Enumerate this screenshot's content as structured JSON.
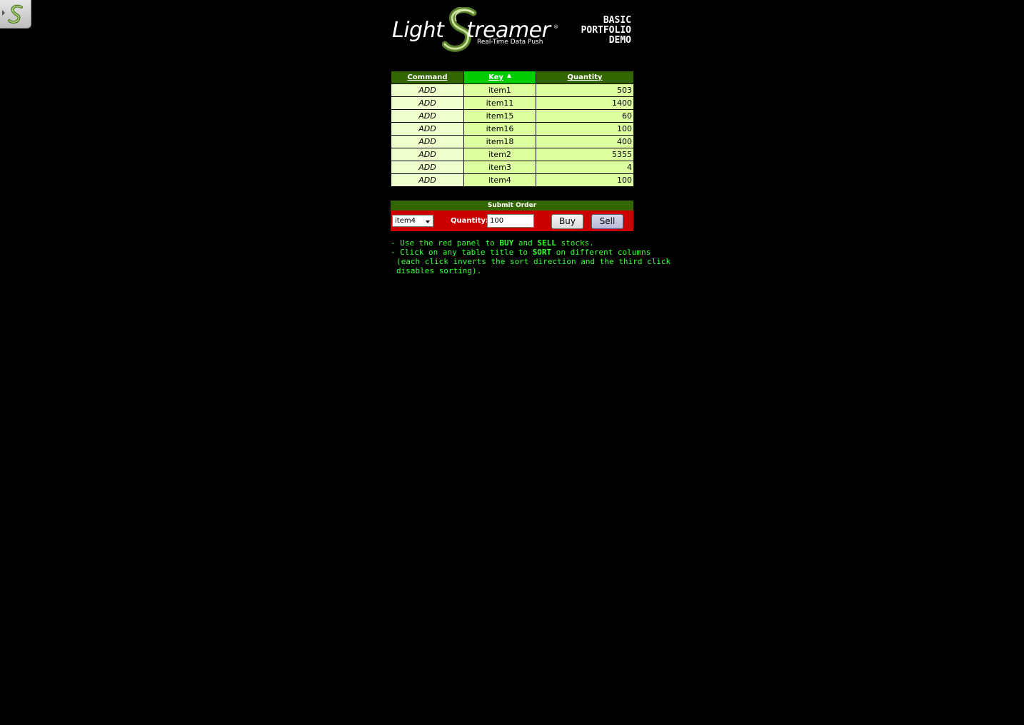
{
  "side_tab": {
    "icon": "lightstreamer-s-icon"
  },
  "header": {
    "logo_light": "Light",
    "logo_s": "S",
    "logo_streamer": "treamer",
    "logo_reg": "®",
    "logo_tagline": "Real-Time Data Push",
    "demo_title_line1": "BASIC",
    "demo_title_line2": "PORTFOLIO",
    "demo_title_line3": "DEMO"
  },
  "table": {
    "columns": [
      "Command",
      "Key",
      "Quantity"
    ],
    "sorted_column": "Key",
    "sort_direction": "ascending",
    "rows": [
      {
        "command": "ADD",
        "key": "item1",
        "quantity": "503"
      },
      {
        "command": "ADD",
        "key": "item11",
        "quantity": "1400"
      },
      {
        "command": "ADD",
        "key": "item15",
        "quantity": "60"
      },
      {
        "command": "ADD",
        "key": "item16",
        "quantity": "100"
      },
      {
        "command": "ADD",
        "key": "item18",
        "quantity": "400"
      },
      {
        "command": "ADD",
        "key": "item2",
        "quantity": "5355"
      },
      {
        "command": "ADD",
        "key": "item3",
        "quantity": "4"
      },
      {
        "command": "ADD",
        "key": "item4",
        "quantity": "100"
      }
    ]
  },
  "order": {
    "title": "Submit Order",
    "selected_item": "item4",
    "quantity_label": "Quantity:",
    "quantity_value": "100",
    "buy_label": "Buy",
    "sell_label": "Sell"
  },
  "instructions": {
    "l1_a": "- Use the red panel to ",
    "l1_b": "BUY",
    "l1_c": " and ",
    "l1_d": "SELL",
    "l1_e": " stocks.",
    "l2_a": "- Click on any table title to ",
    "l2_b": "SORT",
    "l2_c": " on different columns",
    "l3": "(each click inverts the sort direction and the third click",
    "l4": "disables sorting)."
  },
  "colors": {
    "background": "#000000",
    "header_green": "#336600",
    "sorted_header": "#00cc00",
    "row_bg": "#ddff9f",
    "order_red": "#cc0000",
    "instruction_text": "#33ff33"
  }
}
